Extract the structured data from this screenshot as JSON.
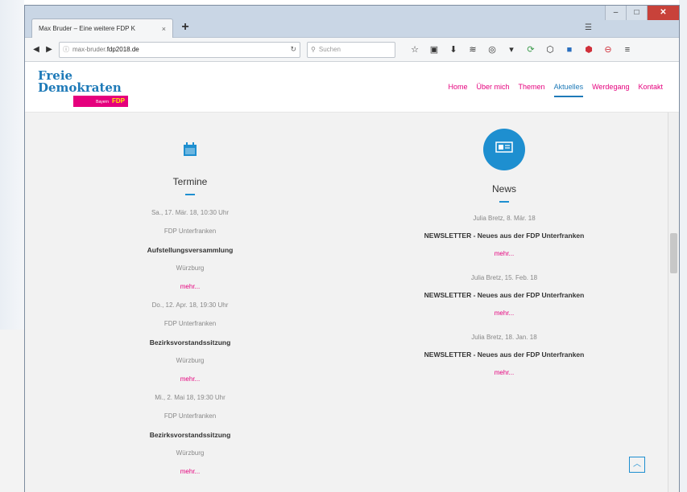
{
  "browser": {
    "tab_title": "Max Bruder – Eine weitere FDP K",
    "tab_close": "×",
    "new_tab": "+",
    "url_domain": "max-bruder.",
    "url_bold": "fdp2018.de",
    "search_placeholder": "Suchen",
    "icons": [
      "star-icon",
      "reader-icon",
      "download-icon",
      "rss-icon",
      "addon-icon",
      "extension-icon",
      "sync-icon",
      "badge-icon",
      "shield-icon",
      "block-icon",
      "menu-icon"
    ]
  },
  "site": {
    "logo_line1": "Freie",
    "logo_line2": "Demokraten",
    "logo_badge_small": "Bayern",
    "logo_badge": "FDP",
    "nav": [
      {
        "label": "Home"
      },
      {
        "label": "Über mich"
      },
      {
        "label": "Themen"
      },
      {
        "label": "Aktuelles",
        "active": true
      },
      {
        "label": "Werdegang"
      },
      {
        "label": "Kontakt"
      }
    ],
    "accent": "#e5007d",
    "brand_blue": "#1e7ab8"
  },
  "termine": {
    "title": "Termine",
    "events": [
      {
        "date": "Sa., 17. Mär. 18, 10:30 Uhr",
        "org": "FDP Unterfranken",
        "title": "Aufstellungsversammlung",
        "place": "Würzburg",
        "more": "mehr..."
      },
      {
        "date": "Do., 12. Apr. 18, 19:30 Uhr",
        "org": "FDP Unterfranken",
        "title": "Bezirksvorstandssitzung",
        "place": "Würzburg",
        "more": "mehr..."
      },
      {
        "date": "Mi., 2. Mai 18, 19:30 Uhr",
        "org": "FDP Unterfranken",
        "title": "Bezirksvorstandssitzung",
        "place": "Würzburg",
        "more": "mehr..."
      }
    ]
  },
  "news": {
    "title": "News",
    "items": [
      {
        "meta": "Julia Bretz, 8. Mär. 18",
        "title": "NEWSLETTER - Neues aus der FDP Unterfranken",
        "more": "mehr..."
      },
      {
        "meta": "Julia Bretz, 15. Feb. 18",
        "title": "NEWSLETTER - Neues aus der FDP Unterfranken",
        "more": "mehr..."
      },
      {
        "meta": "Julia Bretz, 18. Jan. 18",
        "title": "NEWSLETTER - Neues aus der FDP Unterfranken",
        "more": "mehr..."
      }
    ]
  }
}
